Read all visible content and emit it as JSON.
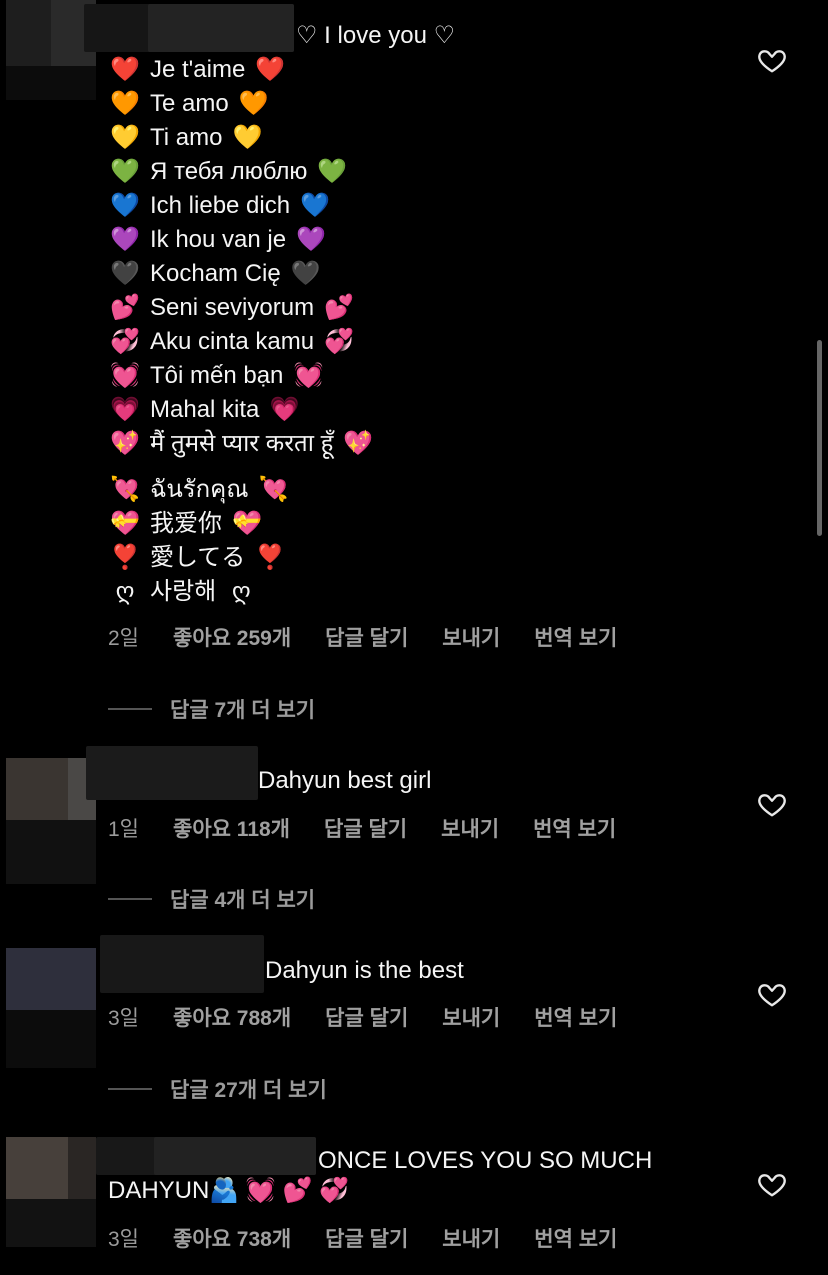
{
  "comments": [
    {
      "lines": [
        {
          "text": "♡ I love you ♡",
          "emoji": ""
        },
        {
          "text": "Je t'aime",
          "emoji": "❤️"
        },
        {
          "text": "Te amo",
          "emoji": "🧡"
        },
        {
          "text": "Ti amo",
          "emoji": "💛"
        },
        {
          "text": "Я тебя люблю",
          "emoji": "💚"
        },
        {
          "text": "Ich liebe dich",
          "emoji": "💙"
        },
        {
          "text": "Ik hou van je",
          "emoji": "💜"
        },
        {
          "text": "Kocham Cię",
          "emoji": "🖤"
        },
        {
          "text": "Seni seviyorum",
          "emoji": "💕"
        },
        {
          "text": "Aku cinta kamu",
          "emoji": "💞"
        },
        {
          "text": "Tôi mến bạn",
          "emoji": "💓"
        },
        {
          "text": "Mahal kita",
          "emoji": "💗"
        },
        {
          "text": "मैं तुमसे प्यार करता हूँ",
          "emoji": "💖"
        },
        {
          "text": "ฉันรักคุณ",
          "emoji": "💘"
        },
        {
          "text": "我爱你",
          "emoji": "💝"
        },
        {
          "text": "愛してる",
          "emoji": "❣️"
        },
        {
          "text": "사랑해",
          "emoji": "ღ"
        }
      ],
      "time": "2일",
      "likes": "좋아요 259개",
      "reply": "답글 달기",
      "send": "보내기",
      "translate": "번역 보기",
      "more_replies": "답글 7개 더 보기"
    },
    {
      "text": "Dahyun best girl",
      "time": "1일",
      "likes": "좋아요 118개",
      "reply": "답글 달기",
      "send": "보내기",
      "translate": "번역 보기",
      "more_replies": "답글 4개 더 보기"
    },
    {
      "text": "Dahyun is the best",
      "time": "3일",
      "likes": "좋아요 788개",
      "reply": "답글 달기",
      "send": "보내기",
      "translate": "번역 보기",
      "more_replies": "답글 27개 더 보기"
    },
    {
      "text": "ONCE LOVES YOU SO MUCH",
      "text2": "DAHYUN🫂 💓 💕 💞",
      "time": "3일",
      "likes": "좋아요 738개",
      "reply": "답글 달기",
      "send": "보내기",
      "translate": "번역 보기"
    }
  ],
  "icons": {
    "like": "heart-outline-icon"
  },
  "colors": {
    "background": "#000000",
    "text": "#f5f5f5",
    "meta": "#9b9b9b"
  }
}
